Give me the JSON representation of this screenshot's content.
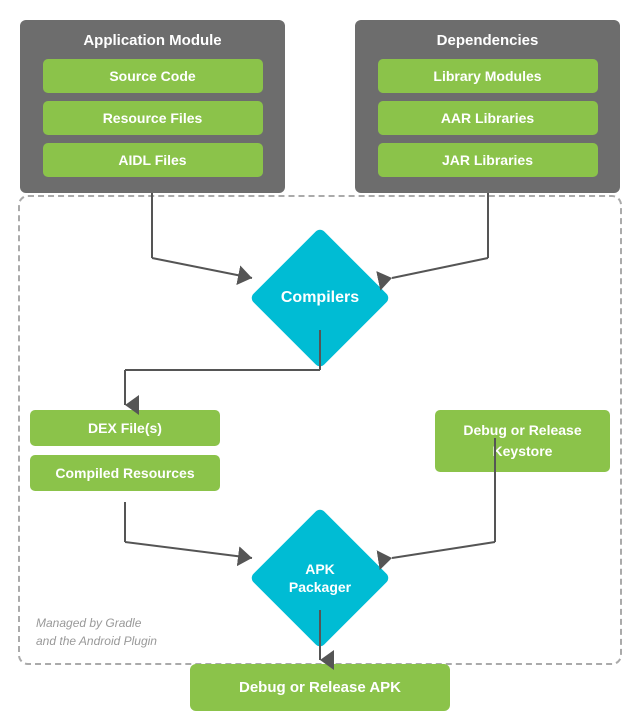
{
  "app_module": {
    "title": "Application Module",
    "items": [
      "Source Code",
      "Resource Files",
      "AIDL Files"
    ]
  },
  "dependencies": {
    "title": "Dependencies",
    "items": [
      "Library Modules",
      "AAR Libraries",
      "JAR Libraries"
    ]
  },
  "compilers": {
    "label": "Compilers"
  },
  "dex_files": {
    "label": "DEX File(s)"
  },
  "compiled_resources": {
    "label": "Compiled Resources"
  },
  "keystore": {
    "label": "Debug or Release Keystore"
  },
  "apk_packager": {
    "label": "APK Packager"
  },
  "output_apk": {
    "label": "Debug or Release APK"
  },
  "gradle_note": {
    "line1": "Managed by Gradle",
    "line2": "and the Android Plugin"
  }
}
